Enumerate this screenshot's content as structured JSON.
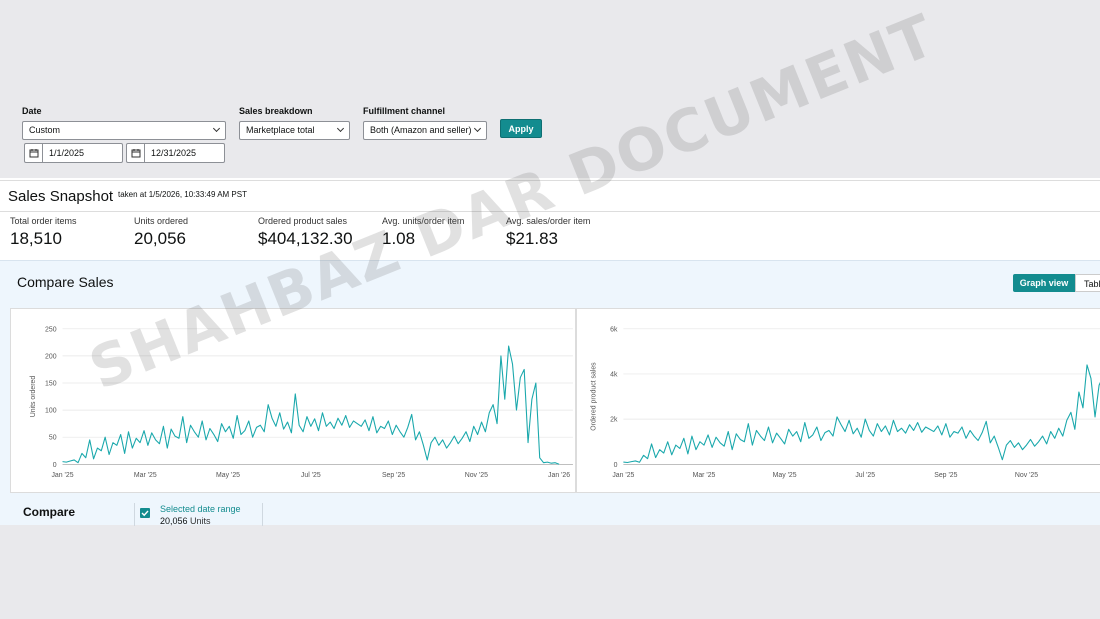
{
  "filters": {
    "date_label": "Date",
    "date_value": "Custom",
    "start_date": "1/1/2025",
    "end_date": "12/31/2025",
    "sales_breakdown_label": "Sales breakdown",
    "sales_breakdown_value": "Marketplace total",
    "fulfillment_label": "Fulfillment channel",
    "fulfillment_value": "Both (Amazon and seller)",
    "apply_label": "Apply"
  },
  "snapshot": {
    "title": "Sales Snapshot",
    "taken": "taken at 1/5/2026, 10:33:49 AM PST",
    "metrics": [
      {
        "label": "Total order items",
        "value": "18,510"
      },
      {
        "label": "Units ordered",
        "value": "20,056"
      },
      {
        "label": "Ordered product sales",
        "value": "$404,132.30"
      },
      {
        "label": "Avg. units/order item",
        "value": "1.08"
      },
      {
        "label": "Avg. sales/order item",
        "value": "$21.83"
      }
    ]
  },
  "compare_sales": {
    "title": "Compare Sales",
    "graph_view": "Graph view",
    "table_view": "Tabl"
  },
  "compare": {
    "title": "Compare",
    "selected_label": "Selected date range",
    "units_value": "20,056",
    "units_suffix": "Units"
  },
  "accent_color": "#138c8f",
  "line_color": "#1aa8ac",
  "watermark": "SHAHBAZ DAR DOCUMENT",
  "chart_data": [
    {
      "type": "line",
      "ylabel": "Units ordered",
      "xlabel": "",
      "ylim": [
        0,
        250
      ],
      "yticks": [
        "0",
        "50",
        "100",
        "150",
        "200",
        "250"
      ],
      "xticks": [
        "Jan '25",
        "Mar '25",
        "May '25",
        "Jul '25",
        "Sep '25",
        "Nov '25",
        "Jan '26"
      ],
      "grid": true,
      "series": [
        {
          "values": [
            5,
            4,
            6,
            8,
            3,
            20,
            12,
            45,
            10,
            30,
            25,
            50,
            18,
            40,
            35,
            55,
            20,
            60,
            30,
            48,
            40,
            62,
            35,
            58,
            45,
            38,
            70,
            30,
            65,
            52,
            48,
            88,
            40,
            72,
            60,
            50,
            80,
            45,
            66,
            55,
            42,
            75,
            60,
            70,
            48,
            90,
            55,
            62,
            80,
            50,
            68,
            72,
            60,
            110,
            85,
            70,
            95,
            65,
            78,
            58,
            130,
            72,
            60,
            88,
            70,
            84,
            62,
            95,
            70,
            78,
            66,
            85,
            72,
            90,
            68,
            80,
            75,
            70,
            82,
            62,
            88,
            58,
            70,
            66,
            80,
            55,
            72,
            60,
            50,
            68,
            92,
            45,
            60,
            36,
            8,
            40,
            50,
            35,
            45,
            30,
            40,
            52,
            38,
            48,
            60,
            42,
            70,
            55,
            78,
            60,
            95,
            110,
            75,
            200,
            120,
            218,
            185,
            100,
            160,
            175,
            40,
            120,
            150,
            12,
            3,
            4,
            2,
            3,
            0
          ]
        }
      ]
    },
    {
      "type": "line",
      "ylabel": "Ordered product sales",
      "xlabel": "",
      "ylim": [
        0,
        6000
      ],
      "yticks": [
        "0",
        "2k",
        "4k",
        "6k"
      ],
      "xticks": [
        "Jan '25",
        "Mar '25",
        "May '25",
        "Jul '25",
        "Sep '25",
        "Nov '25"
      ],
      "grid": true,
      "series": [
        {
          "values": [
            100,
            80,
            120,
            150,
            90,
            400,
            250,
            900,
            300,
            650,
            500,
            1000,
            420,
            850,
            700,
            1150,
            460,
            1250,
            650,
            1000,
            850,
            1300,
            750,
            1200,
            950,
            800,
            1450,
            650,
            1350,
            1100,
            1000,
            1800,
            850,
            1500,
            1250,
            1050,
            1650,
            950,
            1380,
            1150,
            900,
            1550,
            1250,
            1450,
            1000,
            1850,
            1150,
            1300,
            1650,
            1050,
            1400,
            1500,
            1250,
            2100,
            1750,
            1450,
            1950,
            1350,
            1600,
            1200,
            2000,
            1500,
            1250,
            1800,
            1450,
            1700,
            1300,
            1950,
            1450,
            1600,
            1380,
            1750,
            1500,
            1850,
            1420,
            1650,
            1550,
            1450,
            1700,
            1300,
            1800,
            1200,
            1450,
            1380,
            1650,
            1150,
            1500,
            1250,
            1050,
            1400,
            1900,
            950,
            1250,
            750,
            200,
            850,
            1050,
            750,
            950,
            650,
            850,
            1100,
            800,
            1000,
            1250,
            900,
            1450,
            1150,
            1600,
            1250,
            1950,
            2300,
            1550,
            3200,
            2500,
            4400,
            3800,
            2100,
            3500,
            3900
          ]
        }
      ]
    }
  ]
}
